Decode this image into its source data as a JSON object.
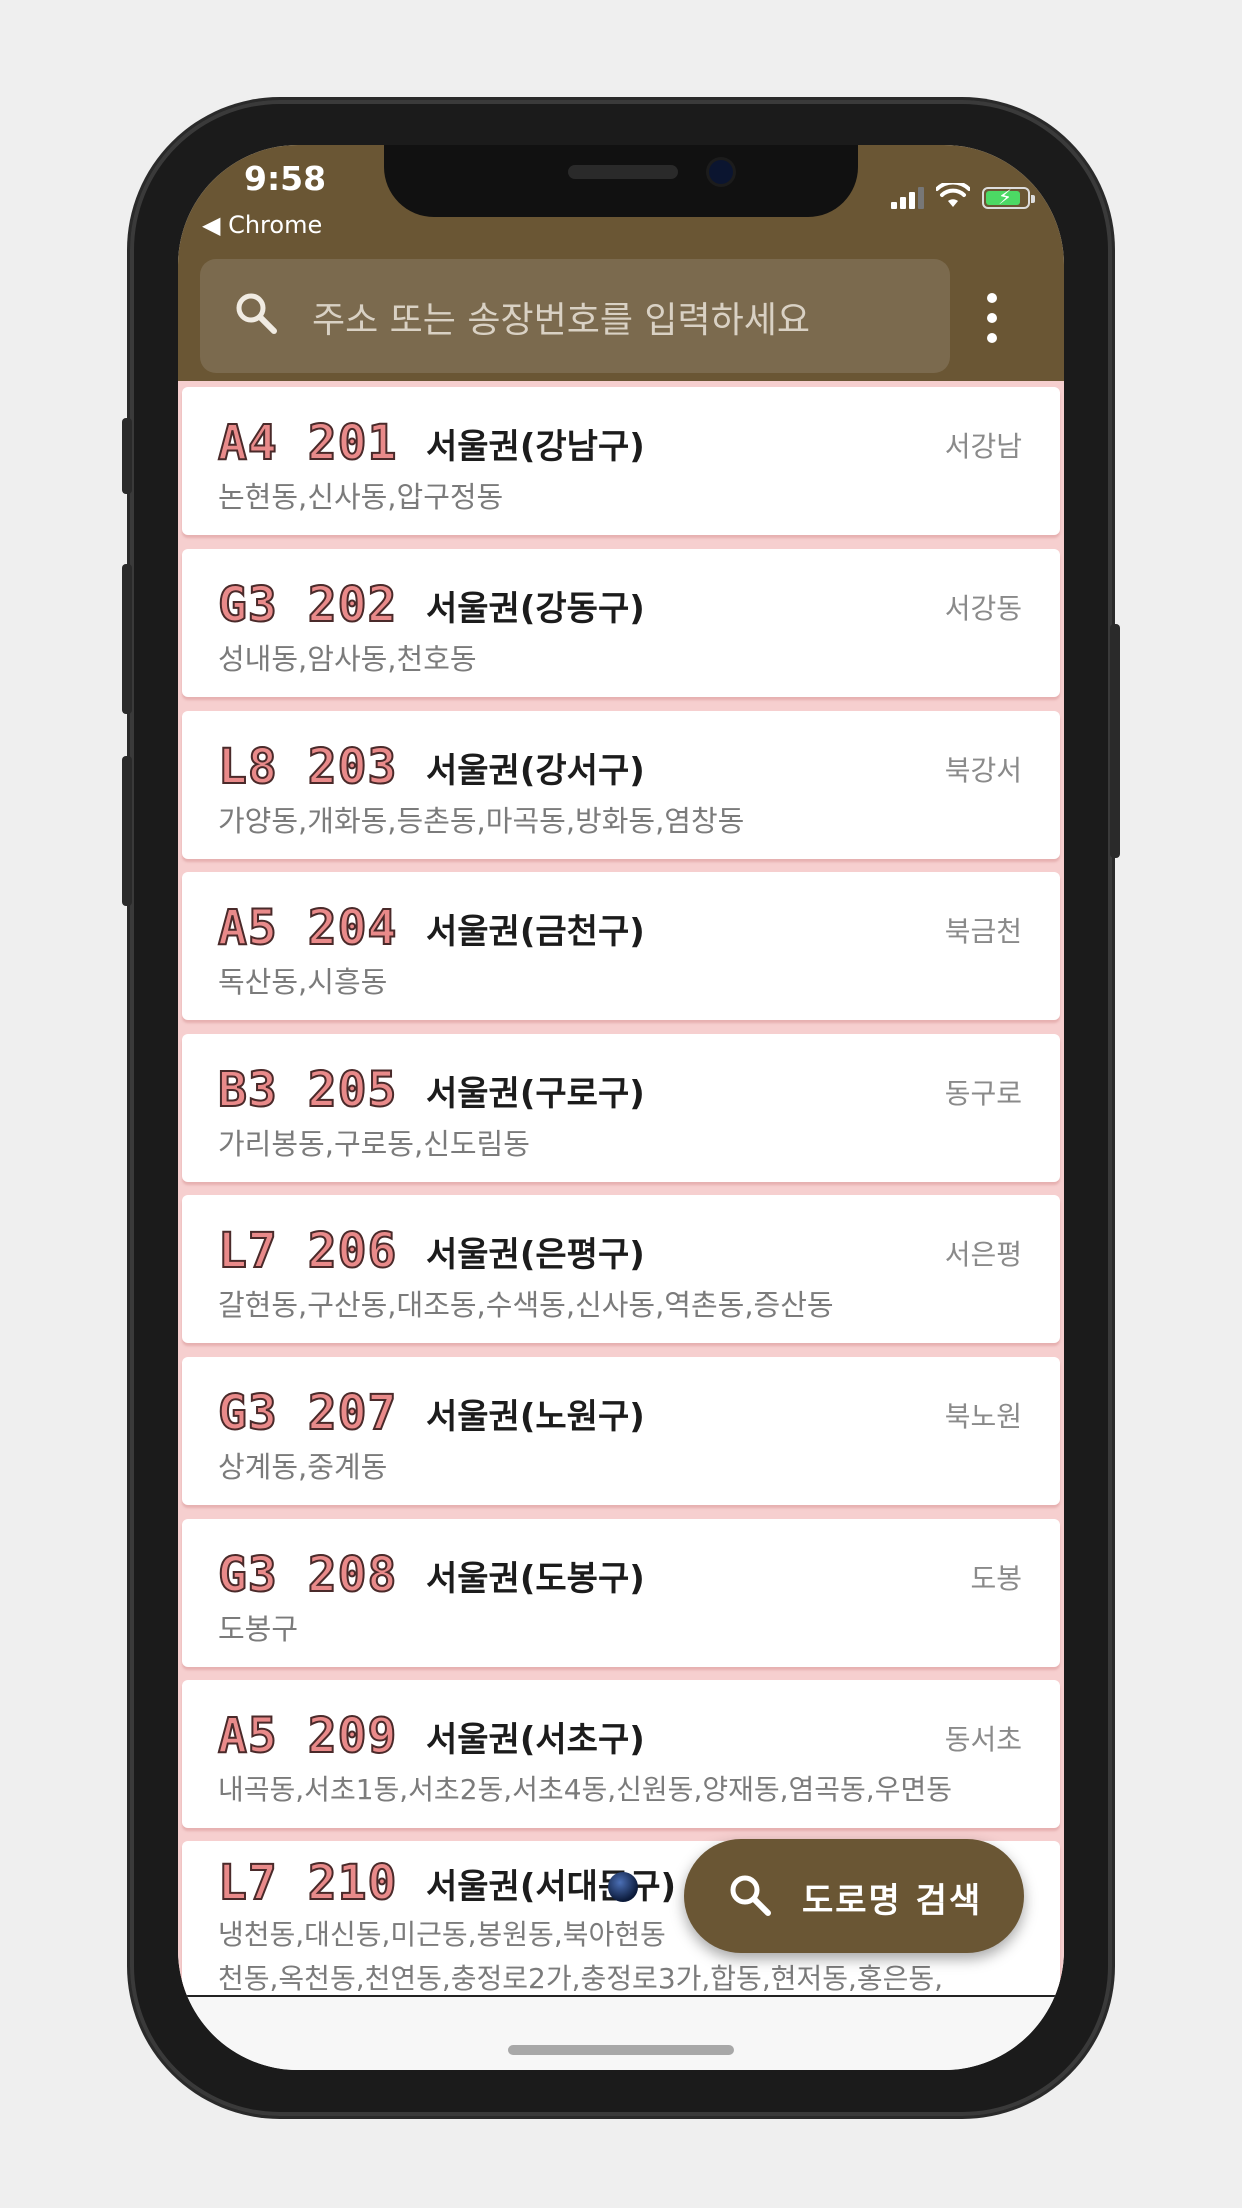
{
  "status_bar": {
    "time": "9:58",
    "back_app": "◀ Chrome"
  },
  "search": {
    "placeholder": "주소 또는 송장번호를 입력하세요",
    "icon": "search-icon"
  },
  "menu_icon": "more-vertical-icon",
  "items": [
    {
      "code": "A4 201",
      "region": "서울권(강남구)",
      "short": "서강남",
      "dongs": "논현동,신사동,압구정동"
    },
    {
      "code": "G3 202",
      "region": "서울권(강동구)",
      "short": "서강동",
      "dongs": "성내동,암사동,천호동"
    },
    {
      "code": "L8 203",
      "region": "서울권(강서구)",
      "short": "북강서",
      "dongs": "가양동,개화동,등촌동,마곡동,방화동,염창동"
    },
    {
      "code": "A5 204",
      "region": "서울권(금천구)",
      "short": "북금천",
      "dongs": "독산동,시흥동"
    },
    {
      "code": "B3 205",
      "region": "서울권(구로구)",
      "short": "동구로",
      "dongs": "가리봉동,구로동,신도림동"
    },
    {
      "code": "L7 206",
      "region": "서울권(은평구)",
      "short": "서은평",
      "dongs": "갈현동,구산동,대조동,수색동,신사동,역촌동,증산동"
    },
    {
      "code": "G3 207",
      "region": "서울권(노원구)",
      "short": "북노원",
      "dongs": "상계동,중계동"
    },
    {
      "code": "G3 208",
      "region": "서울권(도봉구)",
      "short": "도봉",
      "dongs": "도봉구"
    },
    {
      "code": "A5 209",
      "region": "서울권(서초구)",
      "short": "동서초",
      "dongs": "내곡동,서초1동,서초2동,서초4동,신원동,양재동,염곡동,우면동"
    },
    {
      "code": "L7 210",
      "region": "서울권(서대문구)",
      "short": "",
      "dongs": "냉천동,대신동,미근동,봉원동,북아현동",
      "dongs2": "천동,옥천동,천연동,충정로2가,충정로3가,합동,현저동,홍은동,"
    }
  ],
  "fab": {
    "label": "도로명 검색",
    "icon": "search-icon"
  },
  "colors": {
    "header": "#6a5634",
    "list_background": "#f6cfcf",
    "code_fill": "#e98a8a"
  }
}
